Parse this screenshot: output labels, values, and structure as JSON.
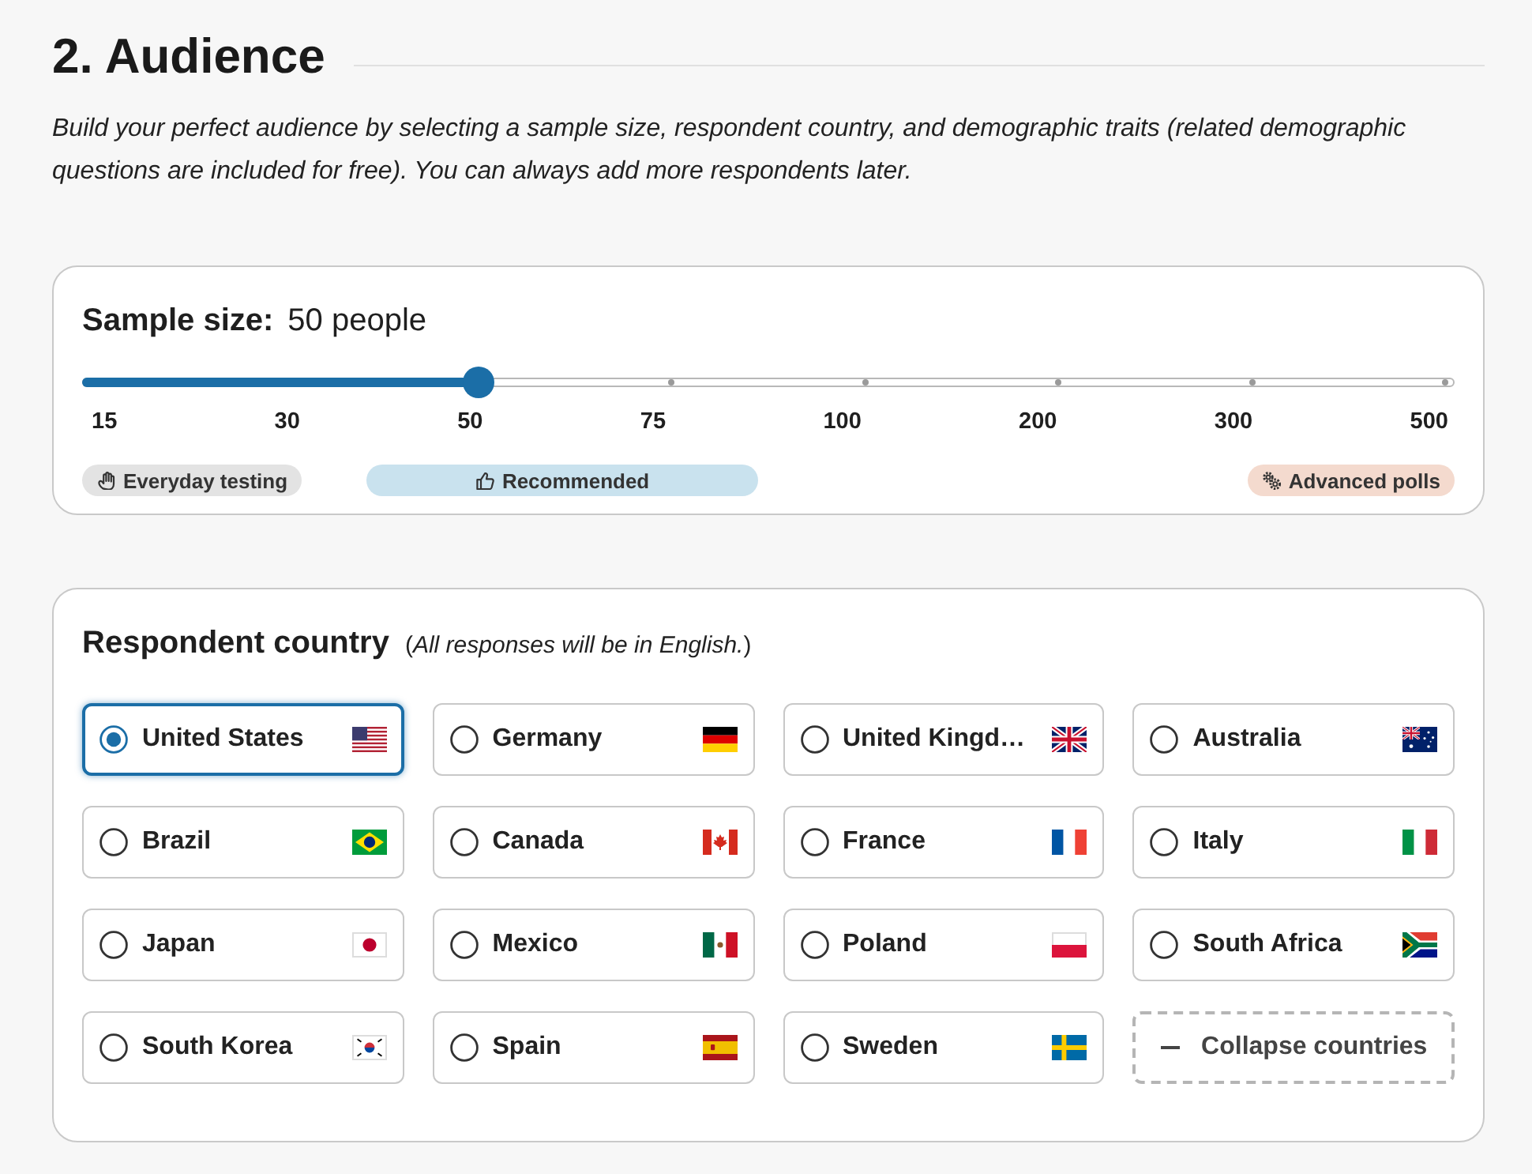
{
  "section": {
    "title": "2. Audience",
    "description": "Build your perfect audience by selecting a sample size, respondent country, and demographic traits (related demographic questions are included for free). You can always add more respondents later."
  },
  "sample_size": {
    "label": "Sample size:",
    "value": "50 people",
    "level": 0.2857,
    "ticks": [
      "15",
      "30",
      "50",
      "75",
      "100",
      "200",
      "300",
      "500"
    ],
    "tags": [
      {
        "label": "Everyday testing",
        "color": "#e3e3e3"
      },
      {
        "label": "Recommended",
        "color": "#c9e2ee"
      },
      {
        "label": "Advanced polls",
        "color": "#f4dace"
      }
    ]
  },
  "respondent_country": {
    "title": "Respondent country",
    "note": "(*All responses will be in English.*)",
    "countries": [
      {
        "name": "United States",
        "selected": true
      },
      {
        "name": "Germany",
        "selected": false
      },
      {
        "name": "United Kingd…",
        "selected": false
      },
      {
        "name": "Australia",
        "selected": false
      },
      {
        "name": "Brazil",
        "selected": false
      },
      {
        "name": "Canada",
        "selected": false
      },
      {
        "name": "France",
        "selected": false
      },
      {
        "name": "Italy",
        "selected": false
      },
      {
        "name": "Japan",
        "selected": false
      },
      {
        "name": "Mexico",
        "selected": false
      },
      {
        "name": "Poland",
        "selected": false
      },
      {
        "name": "South Africa",
        "selected": false
      },
      {
        "name": "South Korea",
        "selected": false
      },
      {
        "name": "Spain",
        "selected": false
      },
      {
        "name": "Sweden",
        "selected": false
      }
    ],
    "collapse_button": {
      "label": "Collapse countries"
    }
  }
}
